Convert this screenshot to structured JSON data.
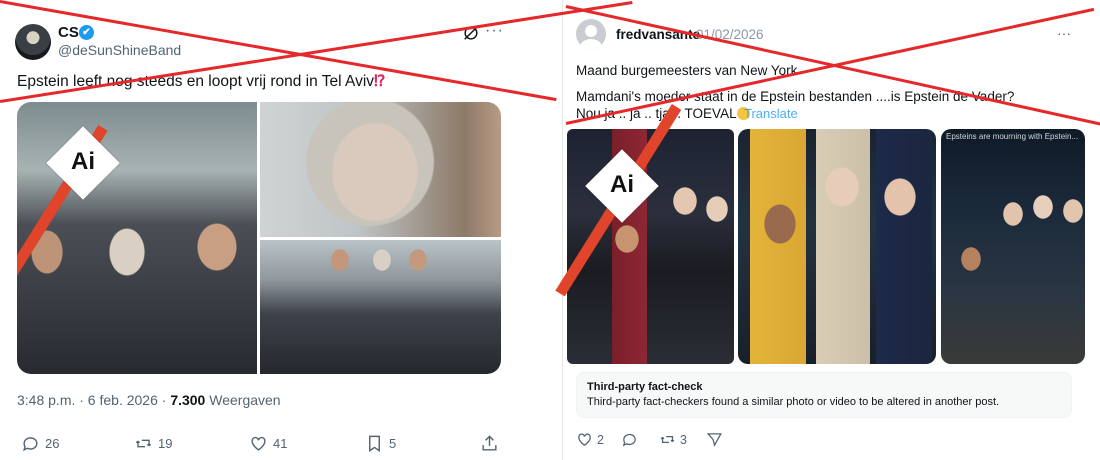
{
  "left_post": {
    "display_name": "CS",
    "verified": "✔",
    "handle": "@deSunShineBand",
    "text": "Epstein leeft nog steeds en loopt vrij rond in Tel Aviv",
    "text_emoji": "⁉",
    "ai_badge": "Ai",
    "timestamp": "3:48 p.m. · 6 feb. 2026 · ",
    "views_count": "7.300",
    "views_label": " Weergaven",
    "actions": {
      "replies": "26",
      "reposts": "19",
      "likes": "41",
      "bookmarks": "5"
    },
    "icons": [
      "grok-icon",
      "more-icon",
      "reply-icon",
      "repost-icon",
      "like-icon",
      "bookmark-icon",
      "share-icon"
    ]
  },
  "right_post": {
    "username": "fredvansante",
    "date": "01/02/2026",
    "more": "···",
    "line1": "Maand burgemeesters van New York",
    "line2": "Mamdani's moeder staat in de Epstein bestanden ....is Epstein de Vader?",
    "line3": "Nou ja .. ja .. tja .. TOEVAL",
    "translate": "Translate",
    "ai_badge": "Ai",
    "photo_caption": "Epsteins are mourning with Epstein...",
    "fact_check_title": "Third-party fact-check",
    "fact_check_body": "Third-party fact-checkers found a similar photo or video to be altered in another post.",
    "actions": {
      "likes": "2",
      "shares": "3"
    },
    "icons": [
      "like-icon",
      "comment-icon",
      "repost-icon",
      "send-icon"
    ]
  },
  "overlay": {
    "cross_color": "#e5282a",
    "slash_color": "#e0442a"
  }
}
